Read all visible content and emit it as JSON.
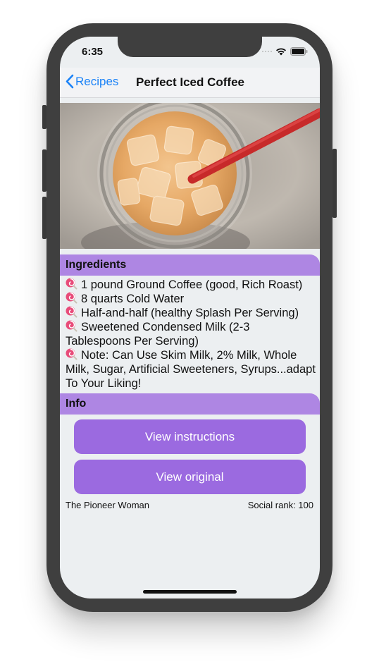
{
  "status_bar": {
    "time": "6:35"
  },
  "nav": {
    "back_label": "Recipes",
    "title": "Perfect Iced Coffee"
  },
  "hero_image": {
    "subject": "iced coffee in a mason jar with a red straw"
  },
  "ingredients": {
    "header": "Ingredients",
    "bullet_icon": "lollipop-icon",
    "items": [
      "1 pound Ground Coffee (good, Rich Roast)",
      "8 quarts Cold Water",
      "Half-and-half (healthy Splash Per Serving)",
      "Sweetened Condensed Milk (2-3 Tablespoons Per Serving)",
      "Note: Can Use Skim Milk, 2% Milk, Whole Milk, Sugar, Artificial Sweeteners, Syrups...adapt To Your Liking!"
    ]
  },
  "info": {
    "header": "Info",
    "view_instructions_label": "View instructions",
    "view_original_label": "View original",
    "publisher": "The Pioneer Woman",
    "social_rank": "Social rank: 100"
  },
  "colors": {
    "accent_purple": "#9b6ae0",
    "header_purple": "#ae86e3",
    "ios_blue": "#1a82f7",
    "screen_background": "#eceff1",
    "device_frame": "#3f3f3f"
  }
}
